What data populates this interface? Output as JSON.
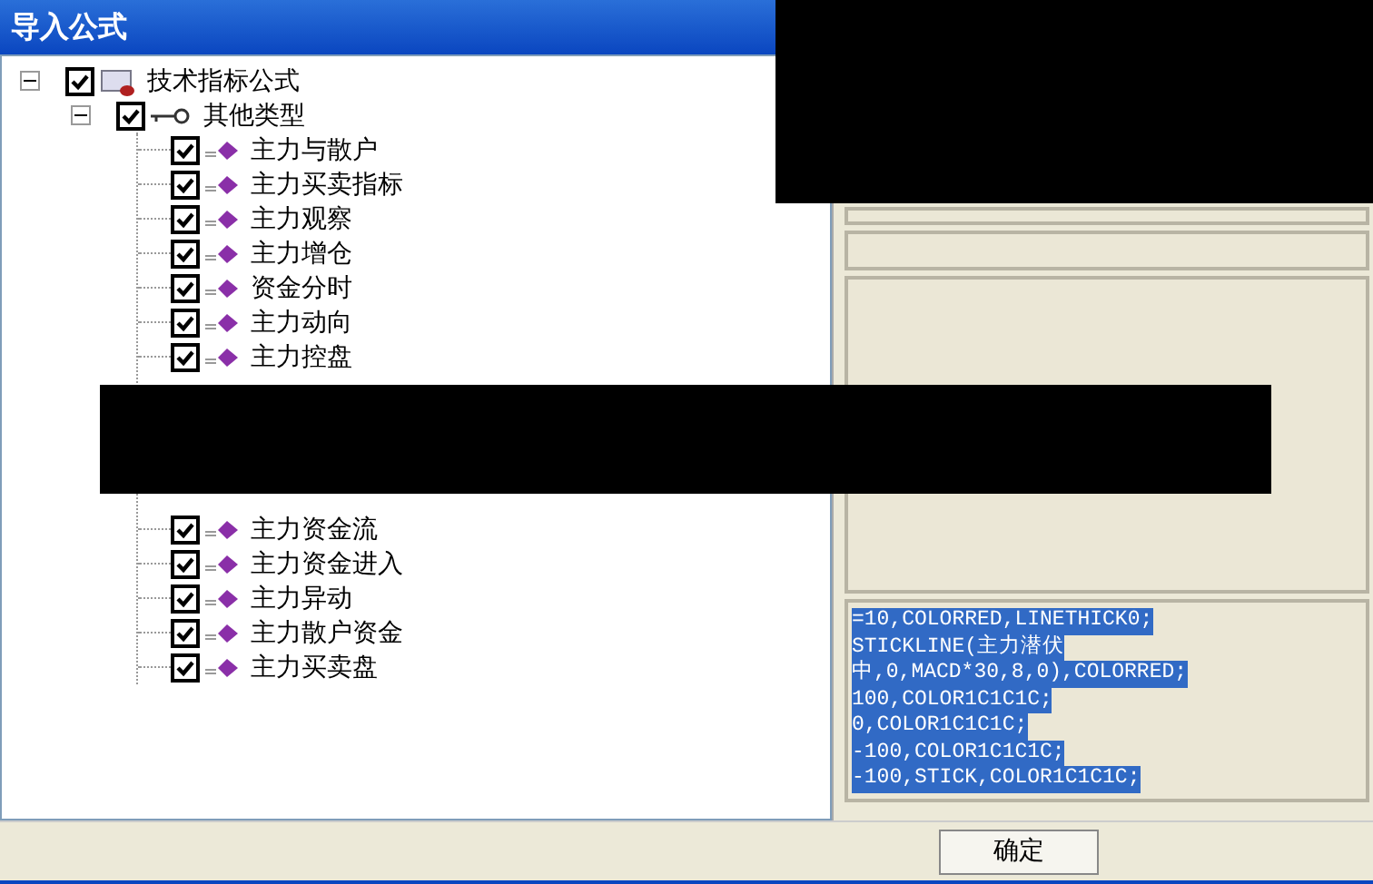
{
  "window": {
    "title": "导入公式"
  },
  "tree": {
    "label": "技术指标公式",
    "checked": true,
    "expanded": true,
    "children": [
      {
        "label": "其他类型",
        "checked": true,
        "expanded": true,
        "children": [
          {
            "kind": "item",
            "label": "主力与散户",
            "checked": true
          },
          {
            "kind": "item",
            "label": "主力买卖指标",
            "checked": true
          },
          {
            "kind": "item",
            "label": "主力观察",
            "checked": true
          },
          {
            "kind": "item",
            "label": "主力增仓",
            "checked": true
          },
          {
            "kind": "item",
            "label": "资金分时",
            "checked": true
          },
          {
            "kind": "item",
            "label": "主力动向",
            "checked": true
          },
          {
            "kind": "item",
            "label": "主力控盘",
            "checked": true
          },
          {
            "kind": "redacted"
          },
          {
            "kind": "item",
            "label": "主力资金流",
            "checked": true
          },
          {
            "kind": "item",
            "label": "主力资金进入",
            "checked": true
          },
          {
            "kind": "item",
            "label": "主力异动",
            "checked": true
          },
          {
            "kind": "item",
            "label": "主力散户资金",
            "checked": true
          },
          {
            "kind": "item",
            "label": "主力买卖盘",
            "checked": true
          }
        ]
      }
    ]
  },
  "formula_lines": [
    "=10,COLORRED,LINETHICK0;",
    "STICKLINE(主力潜伏",
    "中,0,MACD*30,8,0),COLORRED;",
    "100,COLOR1C1C1C;",
    "0,COLOR1C1C1C;",
    "-100,COLOR1C1C1C;",
    "-100,STICK,COLOR1C1C1C;"
  ],
  "buttons": [
    "确定"
  ]
}
